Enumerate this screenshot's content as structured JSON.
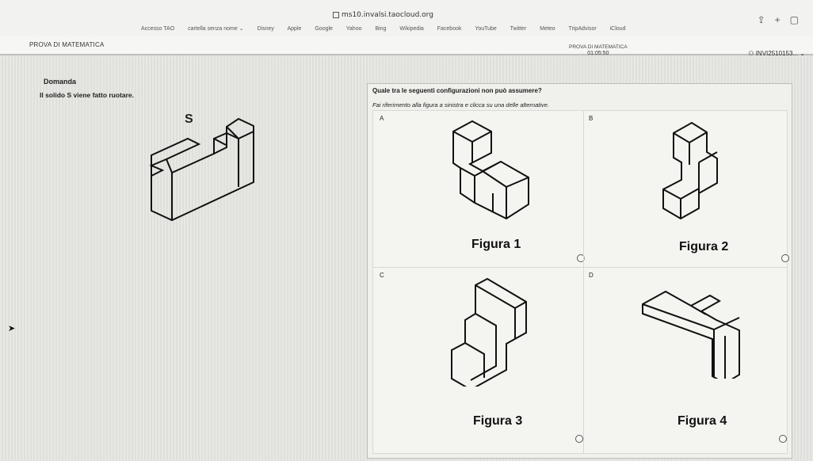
{
  "browser": {
    "url": "ms10.invalsi.taocloud.org",
    "bookmarks": [
      "Accesso TAO",
      "cartella senza nome ⌄",
      "Disney",
      "Apple",
      "Google",
      "Yahoo",
      "Bing",
      "Wikipedia",
      "Facebook",
      "YouTube",
      "Twitter",
      "Meteo",
      "TripAdvisor",
      "iCloud"
    ]
  },
  "app": {
    "title": "PROVA DI MATEMATICA",
    "center_title": "PROVA DI MATEMATICA",
    "timer": "01:05:50",
    "user": "INVI2510153..."
  },
  "question": {
    "section": "Domanda",
    "stem": "Il solido S viene fatto ruotare.",
    "solid_label": "S",
    "prompt": "Quale tra le seguenti configurazioni non può assumere?",
    "hint": "Fai riferimento alla figura a sinistra e clicca su una delle alternative.",
    "options": [
      {
        "letter": "A",
        "caption": "Figura 1"
      },
      {
        "letter": "B",
        "caption": "Figura 2"
      },
      {
        "letter": "C",
        "caption": "Figura 3"
      },
      {
        "letter": "D",
        "caption": "Figura 4"
      }
    ]
  },
  "icons": [
    "lock-icon",
    "share-icon",
    "plus-icon",
    "tabs-icon",
    "user-icon",
    "chevron-down-icon",
    "pointer-icon",
    "radio-icon"
  ]
}
